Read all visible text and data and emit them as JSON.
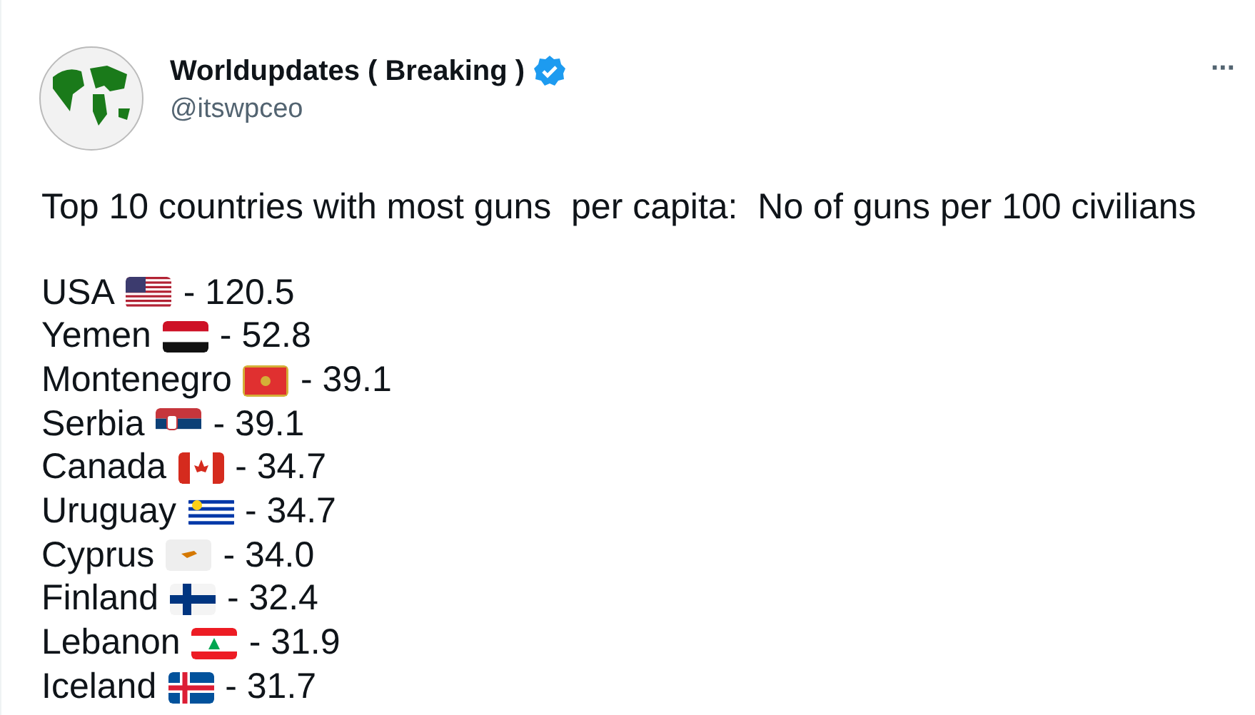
{
  "author": {
    "name": "Worldupdates ( Breaking )",
    "verified": true,
    "handle": "@itswpceo"
  },
  "more_button": "···",
  "text": "Top 10 countries with most guns  per capita:  No of guns per 100 civilians",
  "list": [
    {
      "country": "USA",
      "kind": "us",
      "value": "- 120.5"
    },
    {
      "country": "Yemen",
      "kind": "ye",
      "value": "- 52.8"
    },
    {
      "country": "Montenegro",
      "kind": "me",
      "value": "- 39.1"
    },
    {
      "country": "Serbia",
      "kind": "rs",
      "value": "- 39.1"
    },
    {
      "country": "Canada",
      "kind": "ca",
      "value": "- 34.7"
    },
    {
      "country": "Uruguay",
      "kind": "uy",
      "value": "- 34.7"
    },
    {
      "country": "Cyprus",
      "kind": "cy",
      "value": "- 34.0"
    },
    {
      "country": "Finland",
      "kind": "fi",
      "value": "- 32.4"
    },
    {
      "country": "Lebanon",
      "kind": "lb",
      "value": "- 31.9"
    },
    {
      "country": "Iceland",
      "kind": "is",
      "value": "- 31.7"
    }
  ]
}
